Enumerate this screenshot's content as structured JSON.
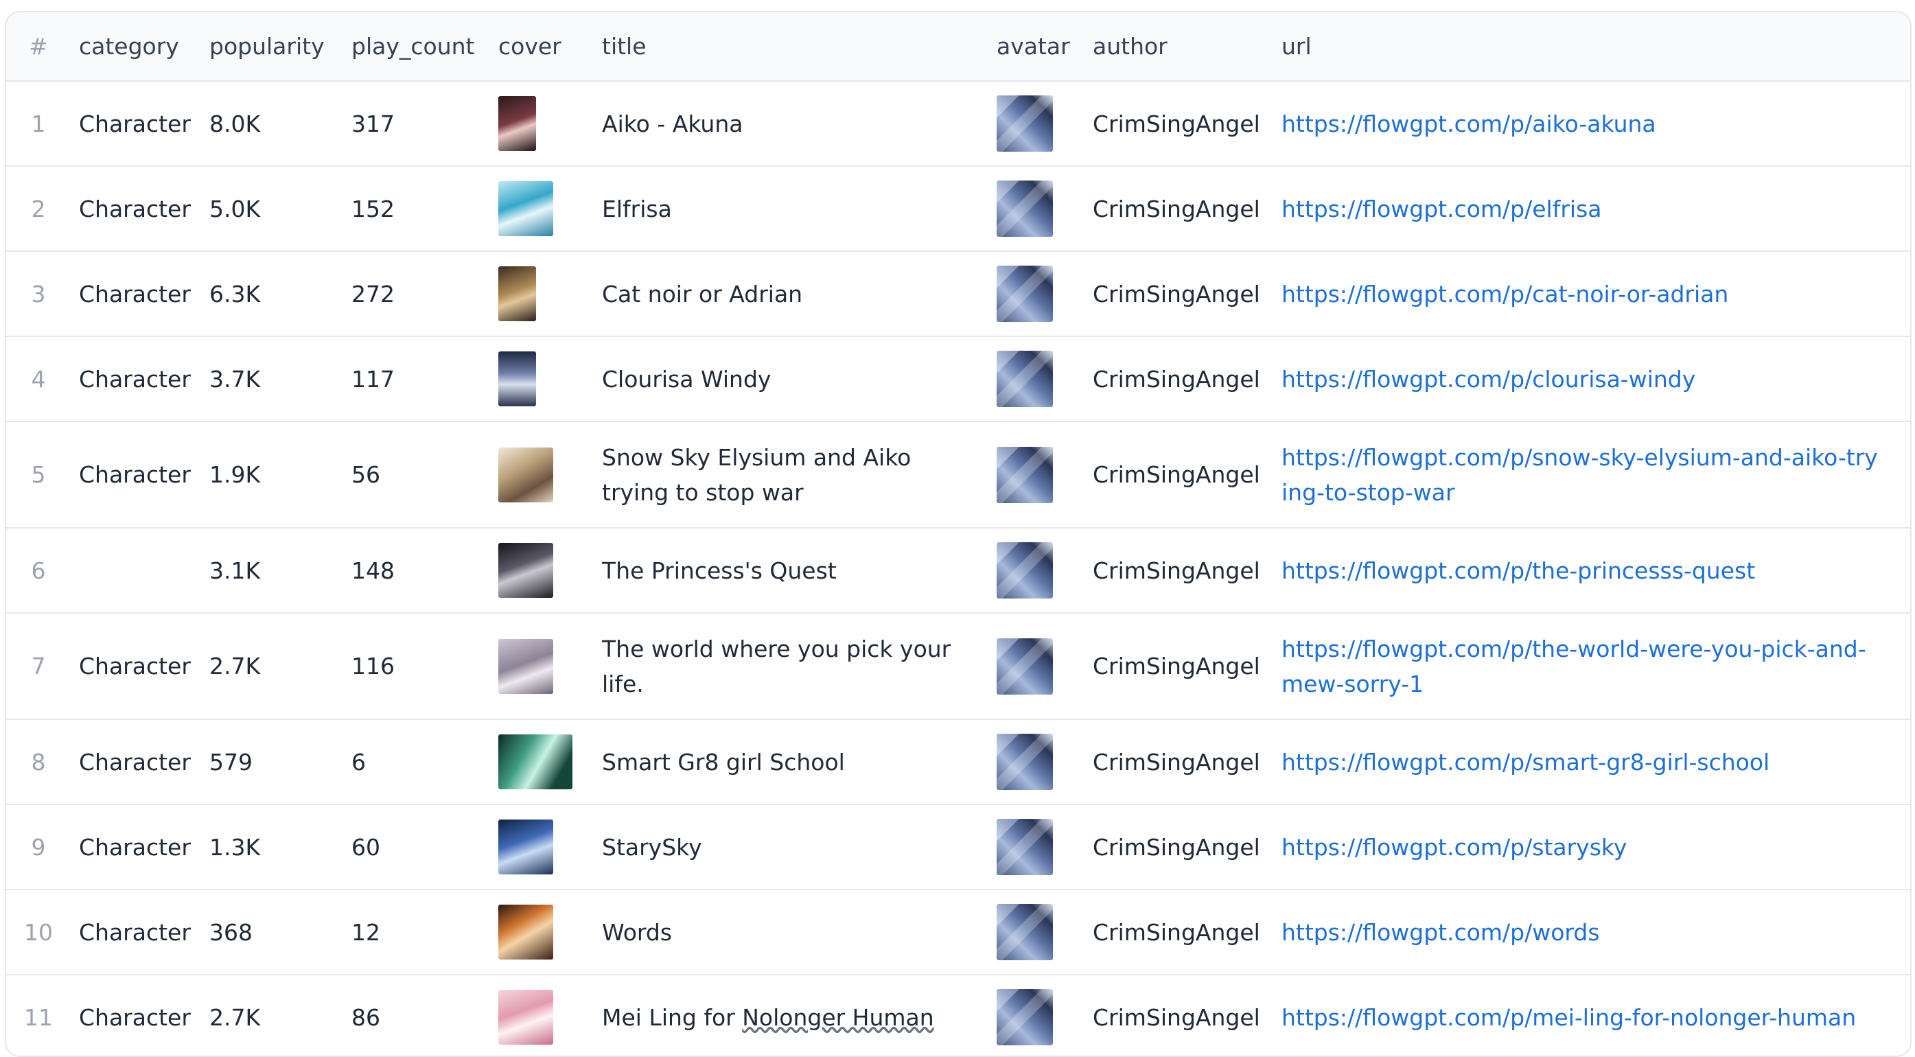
{
  "table": {
    "headers": {
      "index": "#",
      "category": "category",
      "popularity": "popularity",
      "play_count": "play_count",
      "cover": "cover",
      "title": "title",
      "avatar": "avatar",
      "author": "author",
      "url": "url"
    },
    "rows": [
      {
        "index": "1",
        "category": "Character",
        "popularity": "8.0K",
        "play_count": "317",
        "title": "Aiko - Akuna",
        "author": "CrimSingAngel",
        "url": "https://flowgpt.com/p/aiko-akuna"
      },
      {
        "index": "2",
        "category": "Character",
        "popularity": "5.0K",
        "play_count": "152",
        "title": "Elfrisa",
        "author": "CrimSingAngel",
        "url": "https://flowgpt.com/p/elfrisa"
      },
      {
        "index": "3",
        "category": "Character",
        "popularity": "6.3K",
        "play_count": "272",
        "title": "Cat noir or Adrian",
        "author": "CrimSingAngel",
        "url": "https://flowgpt.com/p/cat-noir-or-adrian"
      },
      {
        "index": "4",
        "category": "Character",
        "popularity": "3.7K",
        "play_count": "117",
        "title": "Clourisa Windy",
        "author": "CrimSingAngel",
        "url": "https://flowgpt.com/p/clourisa-windy"
      },
      {
        "index": "5",
        "category": "Character",
        "popularity": "1.9K",
        "play_count": "56",
        "title": "Snow Sky Elysium and Aiko trying to stop war",
        "author": "CrimSingAngel",
        "url": "https://flowgpt.com/p/snow-sky-elysium-and-aiko-trying-to-stop-war"
      },
      {
        "index": "6",
        "category": "",
        "popularity": "3.1K",
        "play_count": "148",
        "title": "The Princess's Quest",
        "author": "CrimSingAngel",
        "url": "https://flowgpt.com/p/the-princesss-quest"
      },
      {
        "index": "7",
        "category": "Character",
        "popularity": "2.7K",
        "play_count": "116",
        "title": "The world where you pick your life.",
        "author": "CrimSingAngel",
        "url": "https://flowgpt.com/p/the-world-were-you-pick-and-mew-sorry-1"
      },
      {
        "index": "8",
        "category": "Character",
        "popularity": "579",
        "play_count": "6",
        "title": "Smart Gr8 girl School",
        "author": "CrimSingAngel",
        "url": "https://flowgpt.com/p/smart-gr8-girl-school"
      },
      {
        "index": "9",
        "category": "Character",
        "popularity": "1.3K",
        "play_count": "60",
        "title": "StarySky",
        "author": "CrimSingAngel",
        "url": "https://flowgpt.com/p/starysky"
      },
      {
        "index": "10",
        "category": "Character",
        "popularity": "368",
        "play_count": "12",
        "title": "Words",
        "author": "CrimSingAngel",
        "url": "https://flowgpt.com/p/words"
      },
      {
        "index": "11",
        "category": "Character",
        "popularity": "2.7K",
        "play_count": "86",
        "title_prefix": "Mei Ling for ",
        "title_marked": "Nolonger Human",
        "author": "CrimSingAngel",
        "url": "https://flowgpt.com/p/mei-ling-for-nolonger-human"
      }
    ]
  },
  "colors": {
    "link": "#1d6fd8",
    "border": "#e5e7eb",
    "header_bg": "#f9fafb",
    "index_text": "#9ca3af"
  }
}
